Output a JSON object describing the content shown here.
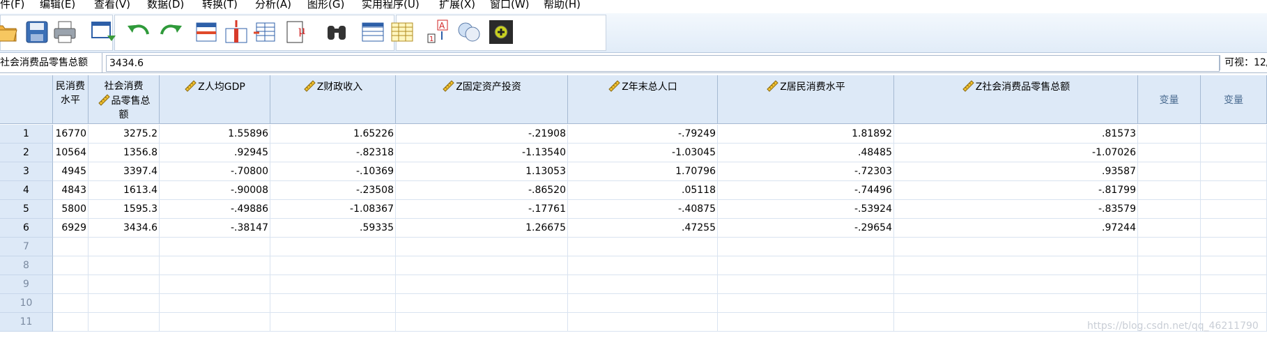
{
  "menu": [
    "件(F)",
    "编辑(E)",
    "查看(V)",
    "数据(D)",
    "转换(T)",
    "分析(A)",
    "图形(G)",
    "实用程序(U)",
    "扩展(X)",
    "窗口(W)",
    "帮助(H)"
  ],
  "toolbar_icons": [
    "open-folder-icon",
    "save-icon",
    "print-icon",
    "dialog-recall-icon",
    "undo-icon",
    "redo-icon",
    "goto-case-icon",
    "goto-variable-icon",
    "variables-icon",
    "run-descriptive-icon",
    "find-icon",
    "insert-cases-icon",
    "insert-variable-icon",
    "split-file-icon",
    "weight-cases-icon",
    "select-cases-icon",
    "value-labels-icon"
  ],
  "editor": {
    "cell_ref": "社会消费品零售总额",
    "cell_value": "3434.6",
    "visible_label": "可视：12/"
  },
  "columns": [
    {
      "label": "民消费\n水平",
      "icon": false
    },
    {
      "label": "社会消费\n品零售总\n额",
      "icon": true
    },
    {
      "label": "Z人均GDP",
      "icon": true
    },
    {
      "label": "Z财政收入",
      "icon": true
    },
    {
      "label": "Z固定资产投资",
      "icon": true
    },
    {
      "label": "Z年末总人口",
      "icon": true
    },
    {
      "label": "Z居民消费水平",
      "icon": true
    },
    {
      "label": "Z社会消费品零售总额",
      "icon": true
    },
    {
      "label": "变量",
      "icon": false,
      "empty": true
    },
    {
      "label": "变量",
      "icon": false,
      "empty": true
    }
  ],
  "rows": [
    {
      "num": "1",
      "cells": [
        "16770",
        "3275.2",
        "1.55896",
        "1.65226",
        "-.21908",
        "-.79249",
        "1.81892",
        ".81573",
        "",
        ""
      ]
    },
    {
      "num": "2",
      "cells": [
        "10564",
        "1356.8",
        ".92945",
        "-.82318",
        "-1.13540",
        "-1.03045",
        ".48485",
        "-1.07026",
        "",
        ""
      ]
    },
    {
      "num": "3",
      "cells": [
        "4945",
        "3397.4",
        "-.70800",
        "-.10369",
        "1.13053",
        "1.70796",
        "-.72303",
        ".93587",
        "",
        ""
      ]
    },
    {
      "num": "4",
      "cells": [
        "4843",
        "1613.4",
        "-.90008",
        "-.23508",
        "-.86520",
        ".05118",
        "-.74496",
        "-.81799",
        "",
        ""
      ]
    },
    {
      "num": "5",
      "cells": [
        "5800",
        "1595.3",
        "-.49886",
        "-1.08367",
        "-.17761",
        "-.40875",
        "-.53924",
        "-.83579",
        "",
        ""
      ]
    },
    {
      "num": "6",
      "cells": [
        "6929",
        "3434.6",
        "-.38147",
        ".59335",
        "1.26675",
        ".47255",
        "-.29654",
        ".97244",
        "",
        ""
      ]
    },
    {
      "num": "7",
      "cells": [
        "",
        "",
        "",
        "",
        "",
        "",
        "",
        "",
        "",
        ""
      ]
    },
    {
      "num": "8",
      "cells": [
        "",
        "",
        "",
        "",
        "",
        "",
        "",
        "",
        "",
        ""
      ]
    },
    {
      "num": "9",
      "cells": [
        "",
        "",
        "",
        "",
        "",
        "",
        "",
        "",
        "",
        ""
      ]
    },
    {
      "num": "10",
      "cells": [
        "",
        "",
        "",
        "",
        "",
        "",
        "",
        "",
        "",
        ""
      ]
    },
    {
      "num": "11",
      "cells": [
        "",
        "",
        "",
        "",
        "",
        "",
        "",
        "",
        "",
        ""
      ]
    }
  ],
  "watermark": "https://blog.csdn.net/qq_46211790",
  "colors": {
    "header_bg": "#dde9f7",
    "grid_line": "#d9e3f0",
    "toolbar_bg": "#e1ecf8"
  }
}
